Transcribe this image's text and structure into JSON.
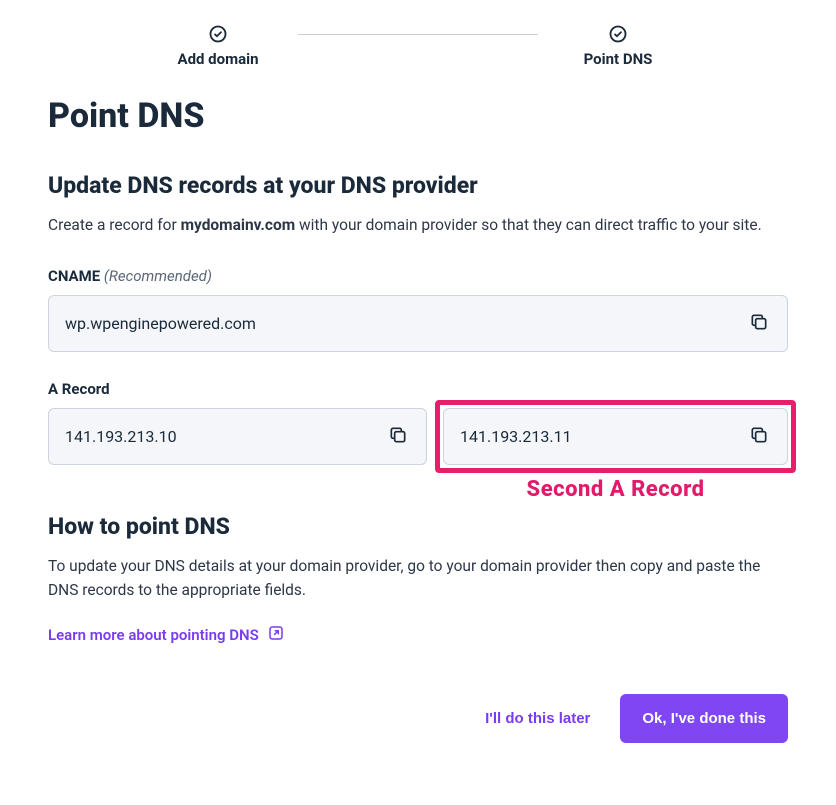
{
  "stepper": {
    "step1_label": "Add domain",
    "step2_label": "Point DNS"
  },
  "page_title": "Point DNS",
  "update_section": {
    "heading": "Update DNS records at your DNS provider",
    "desc_pre": "Create a record for ",
    "domain": "mydomainv.com",
    "desc_post": " with your domain provider so that they can direct traffic to your site.",
    "cname_label": "CNAME",
    "cname_hint": "(Recommended)",
    "cname_value": "wp.wpenginepowered.com",
    "a_record_label": "A Record",
    "a_record_1": "141.193.213.10",
    "a_record_2": "141.193.213.11",
    "annotation": "Second A Record"
  },
  "how_section": {
    "heading": "How to point DNS",
    "desc": "To update your DNS details at your domain provider, go to your domain provider then copy and paste the DNS records to the appropriate fields.",
    "learn_link": "Learn more about pointing DNS"
  },
  "footer": {
    "later": "I'll do this later",
    "done": "Ok, I've done this"
  }
}
